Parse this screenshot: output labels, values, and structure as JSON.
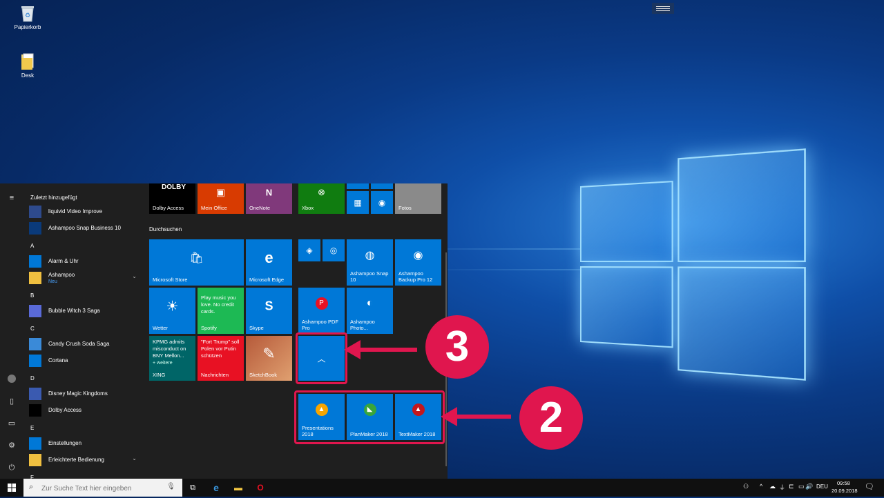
{
  "desktop": {
    "icons": [
      {
        "label": "Papierkorb"
      },
      {
        "label": "Desk"
      }
    ]
  },
  "start_menu": {
    "recent_header": "Zuletzt hinzugefügt",
    "app_list": [
      {
        "type": "item",
        "label": "liquivid Video Improve"
      },
      {
        "type": "item",
        "label": "Ashampoo Snap Business 10"
      },
      {
        "type": "letter",
        "label": "A"
      },
      {
        "type": "item",
        "label": "Alarm & Uhr"
      },
      {
        "type": "item",
        "label": "Ashampoo",
        "sub": "Neu",
        "expand": true
      },
      {
        "type": "letter",
        "label": "B"
      },
      {
        "type": "item",
        "label": "Bubble Witch 3 Saga"
      },
      {
        "type": "letter",
        "label": "C"
      },
      {
        "type": "item",
        "label": "Candy Crush Soda Saga"
      },
      {
        "type": "item",
        "label": "Cortana"
      },
      {
        "type": "letter",
        "label": "D"
      },
      {
        "type": "item",
        "label": "Disney Magic Kingdoms"
      },
      {
        "type": "item",
        "label": "Dolby Access"
      },
      {
        "type": "letter",
        "label": "E"
      },
      {
        "type": "item",
        "label": "Einstellungen"
      },
      {
        "type": "item",
        "label": "Erleichterte Bedienung",
        "expand": true
      },
      {
        "type": "letter",
        "label": "F"
      }
    ],
    "tile_group_header": "Durchsuchen",
    "tiles": {
      "dolby": "Dolby Access",
      "dolby_logo": "DOLBY",
      "office": "Mein Office",
      "onenote": "OneNote",
      "xbox": "Xbox",
      "fotos": "Fotos",
      "store": "Microsoft Store",
      "edge": "Microsoft Edge",
      "weather": "Wetter",
      "spotify_text": "Play music you love. No credit cards.",
      "spotify": "Spotify",
      "skype": "Skype",
      "xing_text": "KPMG admits misconduct on BNY Mellon...",
      "xing_more": "+ weitere",
      "xing": "XING",
      "news_text": "\"Fort Trump\" soll Polen vor Putin schützen",
      "news": "Nachrichten",
      "sketchbook": "SketchBook",
      "snap": "Ashampoo Snap 10",
      "backup": "Ashampoo Backup Pro 12",
      "pdf": "Ashampoo PDF Pro",
      "photo": "Ashampoo Photo...",
      "presentations": "Presentations 2018",
      "planmaker": "PlanMaker 2018",
      "textmaker": "TextMaker 2018"
    }
  },
  "annotations": {
    "badge_3": "3",
    "badge_2": "2"
  },
  "taskbar": {
    "search_placeholder": "Zur Suche Text hier eingeben",
    "language": "DEU",
    "time": "09:58",
    "date": "20.09.2018"
  },
  "colors": {
    "tile_blue": "#0078d7",
    "annotation_red": "#e0164e",
    "start_bg": "#1f1f1f"
  }
}
